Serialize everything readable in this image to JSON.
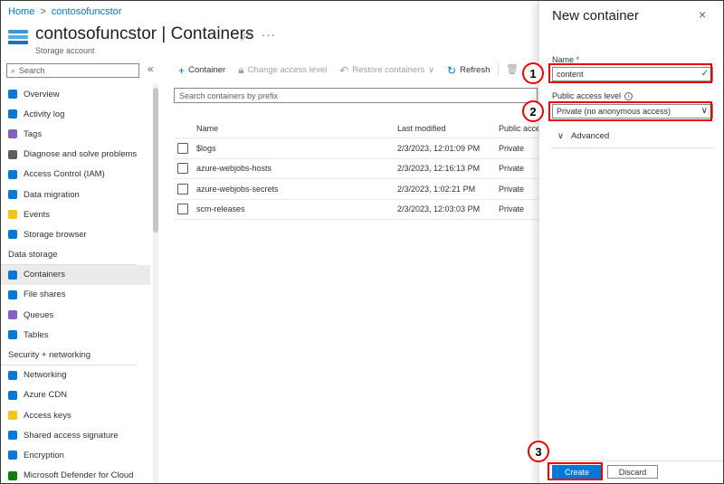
{
  "breadcrumb": {
    "home": "Home",
    "separator": ">",
    "resource": "contosofuncstor"
  },
  "header": {
    "title": "contosofuncstor | Containers",
    "subtitle": "Storage account",
    "pin_icon": "pin-icon",
    "more": "···"
  },
  "sidebar": {
    "search_placeholder": "Search",
    "collapse": "«",
    "items": [
      {
        "label": "Overview",
        "icon": "overview-icon",
        "color": "#0078d4"
      },
      {
        "label": "Activity log",
        "icon": "activity-log-icon",
        "color": "#0078d4"
      },
      {
        "label": "Tags",
        "icon": "tag-icon",
        "color": "#8661c5"
      },
      {
        "label": "Diagnose and solve problems",
        "icon": "wrench-icon",
        "color": "#605e5c"
      },
      {
        "label": "Access Control (IAM)",
        "icon": "people-icon",
        "color": "#0078d4"
      },
      {
        "label": "Data migration",
        "icon": "data-migration-icon",
        "color": "#0078d4"
      },
      {
        "label": "Events",
        "icon": "lightning-icon",
        "color": "#f2c80f"
      },
      {
        "label": "Storage browser",
        "icon": "storage-browser-icon",
        "color": "#0078d4"
      }
    ],
    "section_data_storage": "Data storage",
    "data_storage_items": [
      {
        "label": "Containers",
        "icon": "containers-icon",
        "color": "#0078d4",
        "active": true
      },
      {
        "label": "File shares",
        "icon": "file-shares-icon",
        "color": "#0078d4"
      },
      {
        "label": "Queues",
        "icon": "queues-icon",
        "color": "#8661c5"
      },
      {
        "label": "Tables",
        "icon": "tables-icon",
        "color": "#0078d4"
      }
    ],
    "section_security": "Security + networking",
    "security_items": [
      {
        "label": "Networking",
        "icon": "networking-icon",
        "color": "#0078d4"
      },
      {
        "label": "Azure CDN",
        "icon": "cloud-icon",
        "color": "#0078d4"
      },
      {
        "label": "Access keys",
        "icon": "key-icon",
        "color": "#f2c80f"
      },
      {
        "label": "Shared access signature",
        "icon": "link-icon",
        "color": "#0078d4"
      },
      {
        "label": "Encryption",
        "icon": "lock-icon",
        "color": "#0078d4"
      },
      {
        "label": "Microsoft Defender for Cloud",
        "icon": "shield-icon",
        "color": "#107c10"
      }
    ]
  },
  "toolbar": {
    "add_container": "Container",
    "change_access": "Change access level",
    "restore": "Restore containers",
    "refresh": "Refresh"
  },
  "filter_placeholder": "Search containers by prefix",
  "table": {
    "headers": {
      "name": "Name",
      "modified": "Last modified",
      "access": "Public access level"
    },
    "rows": [
      {
        "name": "$logs",
        "modified": "2/3/2023, 12:01:09 PM",
        "access": "Private"
      },
      {
        "name": "azure-webjobs-hosts",
        "modified": "2/3/2023, 12:16:13 PM",
        "access": "Private"
      },
      {
        "name": "azure-webjobs-secrets",
        "modified": "2/3/2023, 1:02:21 PM",
        "access": "Private"
      },
      {
        "name": "scm-releases",
        "modified": "2/3/2023, 12:03:03 PM",
        "access": "Private"
      }
    ]
  },
  "panel": {
    "title": "New container",
    "close": "×",
    "name_label": "Name",
    "required": "*",
    "name_value": "content",
    "valid_mark": "✓",
    "access_label": "Public access level",
    "info": "i",
    "access_value": "Private (no anonymous access)",
    "advanced": "Advanced",
    "create": "Create",
    "discard": "Discard"
  },
  "callouts": [
    "1",
    "2",
    "3"
  ],
  "colors": {
    "accent": "#0078d4",
    "highlight": "#e00000"
  }
}
